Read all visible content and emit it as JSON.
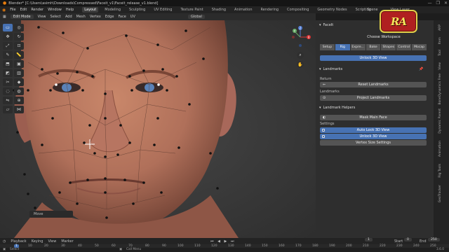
{
  "window": {
    "title": "Blender* [C:\\Users\\asimh\\Downloads\\Compressed\\Faceit_v1\\Faceit_release_v1.blend]",
    "controls": [
      "—",
      "❐",
      "✕"
    ]
  },
  "menubar": {
    "items": [
      "File",
      "Edit",
      "Render",
      "Window",
      "Help"
    ],
    "workspaces": [
      "Layout",
      "Modeling",
      "Sculpting",
      "UV Editing",
      "Texture Paint",
      "Shading",
      "Animation",
      "Rendering",
      "Compositing",
      "Geometry Nodes",
      "Scripting"
    ],
    "active_workspace": "Layout",
    "scene_label": "Scene",
    "view_layer_label": "View Layer"
  },
  "logo_text": "RA",
  "viewport_header": {
    "mode": "Edit Mode",
    "menus": [
      "View",
      "Select",
      "Add",
      "Mesh",
      "Vertex",
      "Edge",
      "Face",
      "UV"
    ],
    "orientation": "Global"
  },
  "gizmo": {
    "z": "Z",
    "y": "Y",
    "x": "X"
  },
  "last_operator": "Move",
  "faceit_panel": {
    "title": "FaceIt",
    "choose_workspace": "Choose Workspace",
    "tabs": [
      "Setup",
      "Rig",
      "Expre...",
      "Bake",
      "Shapes",
      "Control",
      "Mocap"
    ],
    "active_tab": "Rig",
    "unlock_button": "Unlock 3D View",
    "landmarks_title": "Landmarks",
    "return_label": "Return",
    "reset_button": "Reset Landmarks",
    "landmarks_label": "Landmarks",
    "project_button": "Project Landmarks",
    "helpers_title": "Landmark Helpers",
    "mask_button": "Mask Main Face",
    "settings_label": "Settings",
    "auto_lock_button": "Auto Lock 3D View",
    "unlock2_button": "Unlock 3D View",
    "vertex_size_button": "Vertex Size Settings"
  },
  "sidebar_tabs": [
    "ARP",
    "Item",
    "Tool",
    "View",
    "BoneDynamics Free",
    "Dynamic Parent",
    "Animation",
    "Rig Tools",
    "GeoTracker"
  ],
  "timeline": {
    "menus": [
      "Playback",
      "Keying",
      "View",
      "Marker"
    ],
    "current_frame": "1",
    "start_label": "Start",
    "start_value": "0",
    "end_label": "End",
    "end_value": "250",
    "ruler": [
      "1",
      "10",
      "20",
      "30",
      "40",
      "50",
      "60",
      "70",
      "80",
      "90",
      "100",
      "110",
      "120",
      "130",
      "140",
      "150",
      "160",
      "170",
      "180",
      "190",
      "200",
      "210",
      "220",
      "230",
      "240",
      "250"
    ]
  },
  "status": {
    "select": "Select",
    "call_menu": "Call Menu",
    "version": "3.6.0"
  }
}
